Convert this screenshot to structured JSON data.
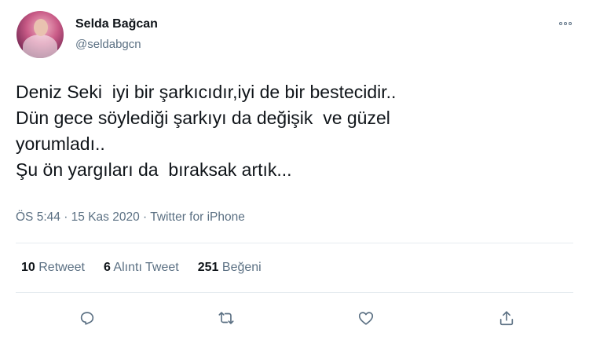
{
  "author": {
    "name": "Selda Bağcan",
    "handle": "@seldabgcn",
    "avatar_icon": "profile-photo"
  },
  "tweet": {
    "lines": [
      "Deniz Seki  iyi bir şarkıcıdır,iyi de bir bestecidir..",
      "Dün gece söylediği şarkıyı da değişik  ve güzel",
      "yorumladı..",
      "Şu ön yargıları da  bıraksak artık..."
    ],
    "time": "ÖS 5:44",
    "date": "15 Kas 2020",
    "source": "Twitter for iPhone",
    "separator": "·"
  },
  "stats": {
    "retweets": {
      "count": "10",
      "label": "Retweet"
    },
    "quotes": {
      "count": "6",
      "label": "Alıntı Tweet"
    },
    "likes": {
      "count": "251",
      "label": "Beğeni"
    }
  },
  "actions": [
    "reply-icon",
    "retweet-icon",
    "like-icon",
    "share-icon"
  ],
  "colors": {
    "text": "#0f1419",
    "secondary": "#5b7083",
    "divider": "#e6ecf0"
  }
}
